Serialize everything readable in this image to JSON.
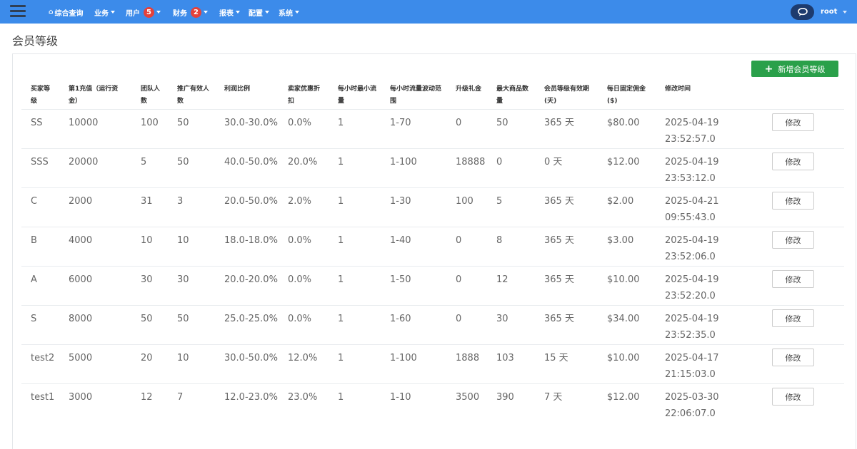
{
  "nav": {
    "items": [
      {
        "label": "综合查询",
        "badge": null
      },
      {
        "label": "业务",
        "badge": null
      },
      {
        "label": "用户",
        "badge": "5"
      },
      {
        "label": "财务",
        "badge": "2"
      },
      {
        "label": "报表",
        "badge": null
      },
      {
        "label": "配置",
        "badge": null
      },
      {
        "label": "系统",
        "badge": null
      }
    ],
    "user": "root",
    "icons": {
      "menu": "hamburger-icon",
      "home": "home-icon",
      "chat": "chat-bubble-icon"
    }
  },
  "page": {
    "title": "会员等级",
    "add_button": "新增会员等级"
  },
  "table": {
    "headers": [
      [
        "买家等",
        "级"
      ],
      [
        "第1充值（运行资",
        "金）"
      ],
      [
        "团队人",
        "数"
      ],
      [
        "推广有效人",
        "数"
      ],
      [
        "利润比例",
        ""
      ],
      [
        "卖家优惠折",
        "扣"
      ],
      [
        "每小时最小流",
        "量"
      ],
      [
        "每小时流量波动范",
        "围"
      ],
      [
        "升级礼金",
        ""
      ],
      [
        "最大商品数",
        "量"
      ],
      [
        "会员等级有效期",
        "(天)"
      ],
      [
        "每日固定佣金",
        "($)"
      ],
      [
        "修改时间",
        ""
      ]
    ],
    "edit_label": "修改",
    "rows": [
      {
        "level": "SS",
        "recharge": "10000",
        "team": "100",
        "promo": "50",
        "profit": "30.0-30.0%",
        "discount": "0.0%",
        "min_flow": "1",
        "flow_range": "1-70",
        "gift": "0",
        "max_goods": "50",
        "validity": "365 天",
        "commission": "$80.00",
        "date": "2025-04-19",
        "time": "23:52:57.0"
      },
      {
        "level": "SSS",
        "recharge": "20000",
        "team": "5",
        "promo": "50",
        "profit": "40.0-50.0%",
        "discount": "20.0%",
        "min_flow": "1",
        "flow_range": "1-100",
        "gift": "18888",
        "max_goods": "0",
        "validity": "0 天",
        "commission": "$12.00",
        "date": "2025-04-19",
        "time": "23:53:12.0"
      },
      {
        "level": "C",
        "recharge": "2000",
        "team": "31",
        "promo": "3",
        "profit": "20.0-50.0%",
        "discount": "2.0%",
        "min_flow": "1",
        "flow_range": "1-30",
        "gift": "100",
        "max_goods": "5",
        "validity": "365 天",
        "commission": "$2.00",
        "date": "2025-04-21",
        "time": "09:55:43.0"
      },
      {
        "level": "B",
        "recharge": "4000",
        "team": "10",
        "promo": "10",
        "profit": "18.0-18.0%",
        "discount": "0.0%",
        "min_flow": "1",
        "flow_range": "1-40",
        "gift": "0",
        "max_goods": "8",
        "validity": "365 天",
        "commission": "$3.00",
        "date": "2025-04-19",
        "time": "23:52:06.0"
      },
      {
        "level": "A",
        "recharge": "6000",
        "team": "30",
        "promo": "30",
        "profit": "20.0-20.0%",
        "discount": "0.0%",
        "min_flow": "1",
        "flow_range": "1-50",
        "gift": "0",
        "max_goods": "12",
        "validity": "365 天",
        "commission": "$10.00",
        "date": "2025-04-19",
        "time": "23:52:20.0"
      },
      {
        "level": "S",
        "recharge": "8000",
        "team": "50",
        "promo": "50",
        "profit": "25.0-25.0%",
        "discount": "0.0%",
        "min_flow": "1",
        "flow_range": "1-60",
        "gift": "0",
        "max_goods": "30",
        "validity": "365 天",
        "commission": "$34.00",
        "date": "2025-04-19",
        "time": "23:52:35.0"
      },
      {
        "level": "test2",
        "recharge": "5000",
        "team": "20",
        "promo": "10",
        "profit": "30.0-50.0%",
        "discount": "12.0%",
        "min_flow": "1",
        "flow_range": "1-100",
        "gift": "1888",
        "max_goods": "103",
        "validity": "15 天",
        "commission": "$10.00",
        "date": "2025-04-17",
        "time": "21:15:03.0"
      },
      {
        "level": "test1",
        "recharge": "3000",
        "team": "12",
        "promo": "7",
        "profit": "12.0-23.0%",
        "discount": "23.0%",
        "min_flow": "1",
        "flow_range": "1-10",
        "gift": "3500",
        "max_goods": "390",
        "validity": "7 天",
        "commission": "$12.00",
        "date": "2025-03-30",
        "time": "22:06:07.0"
      }
    ]
  },
  "colors": {
    "topbar": "#3c8bea",
    "badge": "#e5413b",
    "add_button": "#2aa04a",
    "chat_button": "#1d3b6e"
  }
}
